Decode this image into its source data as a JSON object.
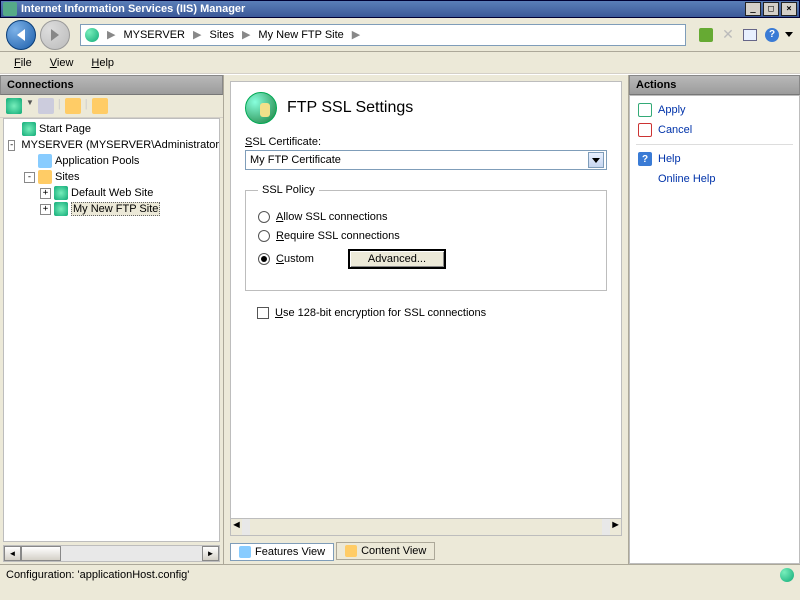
{
  "window": {
    "title": "Internet Information Services (IIS) Manager"
  },
  "breadcrumb": {
    "root": "MYSERVER",
    "mid": "Sites",
    "leaf": "My New FTP Site"
  },
  "menu": {
    "file": "File",
    "view": "View",
    "help": "Help"
  },
  "panels": {
    "connections": "Connections",
    "actions": "Actions"
  },
  "tree": {
    "start_page": "Start Page",
    "server": "MYSERVER (MYSERVER\\Administrator)",
    "app_pools": "Application Pools",
    "sites": "Sites",
    "default_site": "Default Web Site",
    "ftp_site": "My New FTP Site"
  },
  "page": {
    "title": "FTP SSL Settings",
    "ssl_cert_label": "SSL Certificate:",
    "ssl_cert_value": "My FTP Certificate",
    "ssl_policy_legend": "SSL Policy",
    "opt_allow": "Allow SSL connections",
    "opt_require": "Require SSL connections",
    "opt_custom": "Custom",
    "advanced_btn": "Advanced...",
    "use_128": "Use 128-bit encryption for SSL connections"
  },
  "tabs": {
    "features": "Features View",
    "content": "Content View"
  },
  "actions": {
    "apply": "Apply",
    "cancel": "Cancel",
    "help": "Help",
    "online_help": "Online Help"
  },
  "status": {
    "config": "Configuration: 'applicationHost.config'"
  }
}
